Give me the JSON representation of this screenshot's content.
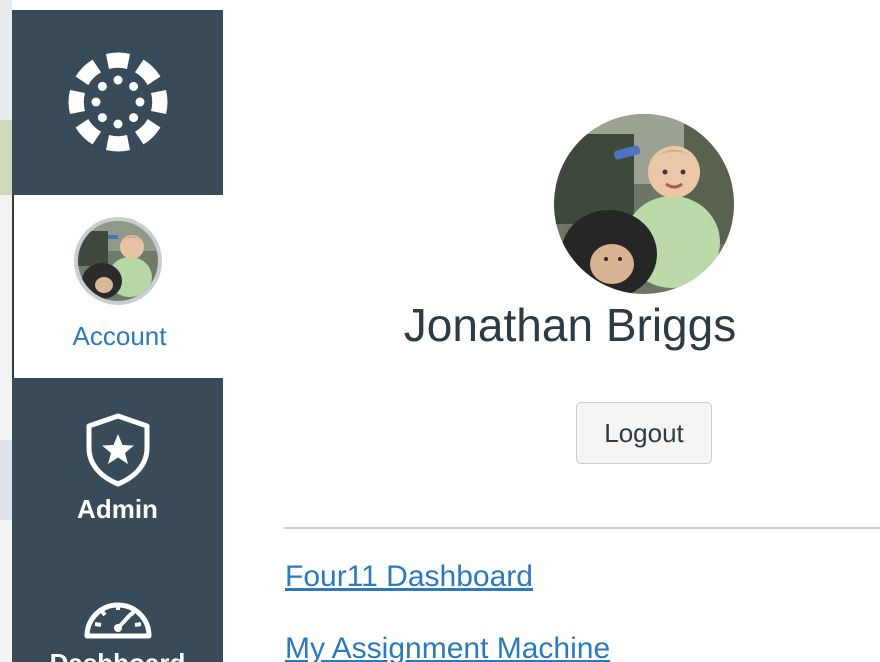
{
  "sidebar": {
    "account_label": "Account",
    "admin_label": "Admin",
    "dashboard_label": "Dashboard",
    "logo_icon": "canvas-logo-icon",
    "admin_icon": "shield-star-icon",
    "dashboard_icon": "speedometer-icon"
  },
  "profile": {
    "name": "Jonathan Briggs",
    "logout_label": "Logout"
  },
  "links": [
    {
      "label": "Four11 Dashboard"
    },
    {
      "label": "My Assignment Machine"
    }
  ],
  "colors": {
    "sidebar_bg": "#394b58",
    "link": "#2b7abc",
    "text": "#2d3b45"
  }
}
